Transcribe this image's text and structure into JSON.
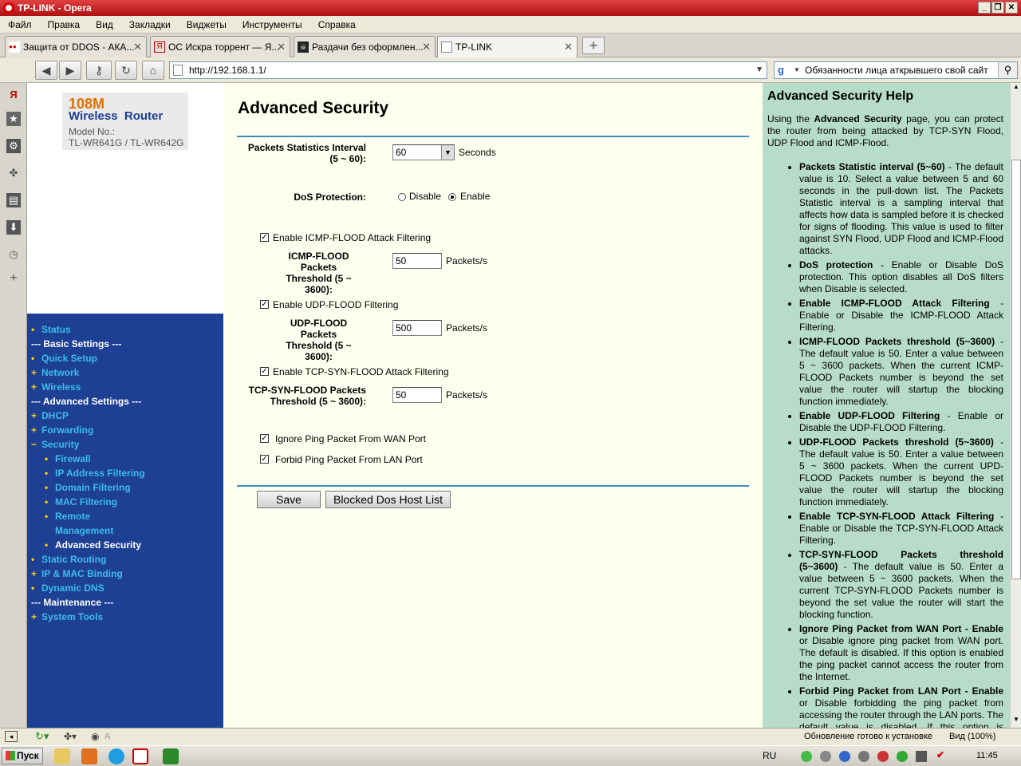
{
  "window": {
    "title": "TP-LINK - Opera"
  },
  "menubar": [
    "Файл",
    "Правка",
    "Вид",
    "Закладки",
    "Виджеты",
    "Инструменты",
    "Справка"
  ],
  "tabs": [
    {
      "label": "Защита от DDOS - АКА...",
      "active": false
    },
    {
      "label": "ОС Искра торрент — Я...",
      "active": false
    },
    {
      "label": "Раздачи без оформлен...",
      "active": false
    },
    {
      "label": "TP-LINK",
      "active": true
    }
  ],
  "address": {
    "url": "http://192.168.1.1/"
  },
  "search": {
    "value": "Обязанности лица аткрывшего свой сайт"
  },
  "router": {
    "speed": "108M",
    "product": "Wireless  Router",
    "model_label": "Model No.:",
    "model": "TL-WR641G / TL-WR642G"
  },
  "nav": [
    {
      "label": "Status",
      "type": "dot",
      "level": 0,
      "white": false
    },
    {
      "label": "--- Basic Settings ---",
      "type": "none",
      "level": 0,
      "white": true
    },
    {
      "label": "Quick Setup",
      "type": "dot",
      "level": 0,
      "white": false
    },
    {
      "label": "Network",
      "type": "plus",
      "level": 0,
      "white": false
    },
    {
      "label": "Wireless",
      "type": "plus",
      "level": 0,
      "white": false
    },
    {
      "label": "--- Advanced Settings ---",
      "type": "none",
      "level": 0,
      "white": true
    },
    {
      "label": "DHCP",
      "type": "plus",
      "level": 0,
      "white": false
    },
    {
      "label": "Forwarding",
      "type": "plus",
      "level": 0,
      "white": false
    },
    {
      "label": "Security",
      "type": "minus",
      "level": 0,
      "white": false
    },
    {
      "label": "Firewall",
      "type": "dot",
      "level": 1,
      "white": false
    },
    {
      "label": "IP Address Filtering",
      "type": "dot",
      "level": 1,
      "white": false
    },
    {
      "label": "Domain Filtering",
      "type": "dot",
      "level": 1,
      "white": false
    },
    {
      "label": "MAC Filtering",
      "type": "dot",
      "level": 1,
      "white": false
    },
    {
      "label": "Remote",
      "type": "dot",
      "level": 1,
      "white": false
    },
    {
      "label": "Management",
      "type": "none",
      "level": 1,
      "white": false
    },
    {
      "label": "Advanced Security",
      "type": "dot",
      "level": 1,
      "white": true
    },
    {
      "label": "Static Routing",
      "type": "dot",
      "level": 0,
      "white": false
    },
    {
      "label": "IP & MAC Binding",
      "type": "plus",
      "level": 0,
      "white": false
    },
    {
      "label": "Dynamic DNS",
      "type": "dot",
      "level": 0,
      "white": false
    },
    {
      "label": "--- Maintenance ---",
      "type": "none",
      "level": 0,
      "white": true
    },
    {
      "label": "System Tools",
      "type": "plus",
      "level": 0,
      "white": false
    }
  ],
  "page": {
    "title": "Advanced Security",
    "interval_label_1": "Packets Statistics Interval",
    "interval_label_2": "(5 ~ 60):",
    "interval_value": "60",
    "interval_unit": "Seconds",
    "dos_label": "DoS Protection:",
    "dos_disable": "Disable",
    "dos_enable": "Enable",
    "icmp_check": "Enable ICMP-FLOOD Attack Filtering",
    "icmp_label_1": "ICMP-FLOOD Packets",
    "icmp_label_2": "Threshold (5 ~ 3600):",
    "icmp_value": "50",
    "udp_check": "Enable UDP-FLOOD Filtering",
    "udp_label_1": "UDP-FLOOD Packets",
    "udp_label_2": "Threshold (5 ~ 3600):",
    "udp_value": "500",
    "tcp_check": "Enable TCP-SYN-FLOOD Attack Filtering",
    "tcp_label_1": "TCP-SYN-FLOOD Packets",
    "tcp_label_2": "Threshold (5 ~ 3600):",
    "tcp_value": "50",
    "unit": "Packets/s",
    "wan_ping": "Ignore Ping Packet From WAN Port",
    "lan_ping": "Forbid Ping Packet From LAN Port",
    "save": "Save",
    "blocked": "Blocked Dos Host List"
  },
  "help": {
    "title": "Advanced Security Help",
    "intro_1": "Using the ",
    "intro_b": "Advanced Security",
    "intro_2": " page, you can protect the router from being attacked by TCP-SYN Flood, UDP Flood and ICMP-Flood.",
    "items": [
      {
        "b": "Packets Statistic interval (5~60)",
        "t": " - The default value is 10. Select a value between 5 and 60 seconds in the pull-down list. The Packets Statistic interval is a sampling interval that affects how data is sampled before it is checked for signs of flooding. This value is used to filter against SYN Flood, UDP Flood and ICMP-Flood attacks."
      },
      {
        "b": "DoS protection",
        "t": " - Enable or Disable DoS protection. This option disables all DoS filters when Disable is selected."
      },
      {
        "b": "Enable ICMP-FLOOD Attack Filtering",
        "t": " - Enable or Disable the ICMP-FLOOD Attack Filtering."
      },
      {
        "b": "ICMP-FLOOD Packets threshold (5~3600)",
        "t": " - The default value is 50. Enter a value between 5 ~ 3600 packets. When the current ICMP-FLOOD Packets number is beyond the set value the router will startup the blocking function immediately."
      },
      {
        "b": "Enable UDP-FLOOD Filtering",
        "t": " - Enable or Disable the UDP-FLOOD Filtering."
      },
      {
        "b": "UDP-FLOOD Packets threshold (5~3600)",
        "t": " - The default value is 50. Enter a value between 5 ~ 3600 packets. When the current UPD-FLOOD Packets number is beyond the set value the router will startup the blocking function immediately."
      },
      {
        "b": "Enable TCP-SYN-FLOOD Attack Filtering",
        "t": " - Enable or Disable the TCP-SYN-FLOOD Attack Filtering."
      },
      {
        "b": "TCP-SYN-FLOOD Packets threshold (5~3600)",
        "t": " - The default value is 50. Enter a value between 5 ~ 3600 packets. When the current TCP-SYN-FLOOD Packets number is beyond the set value the router will start the blocking function."
      },
      {
        "b": "Ignore Ping Packet from WAN Port - Enable",
        "t": " or Disable ignore ping packet from WAN port. The default is disabled. If this option is enabled the ping packet cannot access the router from the Internet."
      },
      {
        "b": "Forbid Ping Packet from LAN Port - Enable",
        "t": " or Disable forbidding the ping packet from accessing the router through the LAN ports. The default value is disabled. If this option is enabled the ping packet cannot access the"
      }
    ]
  },
  "status": {
    "text": "Обновление готово к установке",
    "zoom": "Вид (100%)",
    "a": "A"
  },
  "taskbar": {
    "start": "Пуск",
    "lang": "RU",
    "time": "11:45"
  }
}
